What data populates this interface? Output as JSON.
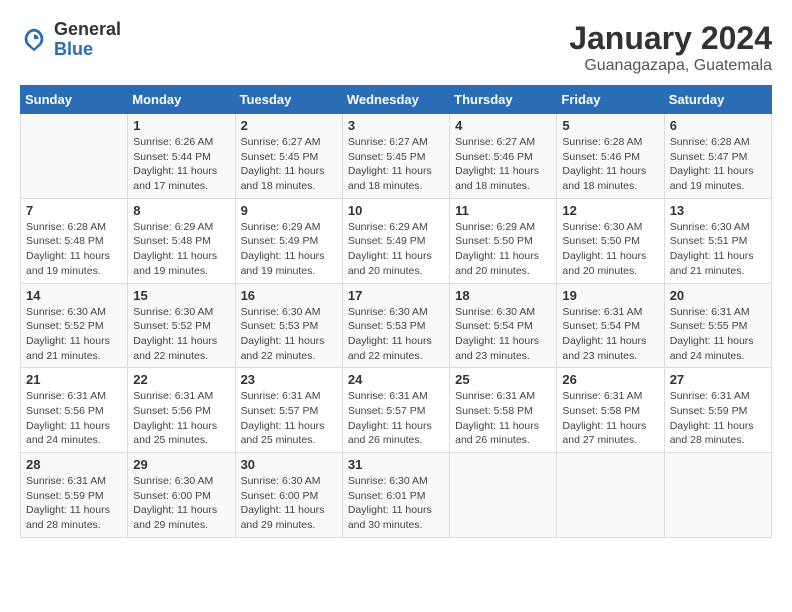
{
  "logo": {
    "general": "General",
    "blue": "Blue"
  },
  "title": "January 2024",
  "location": "Guanagazapa, Guatemala",
  "days_of_week": [
    "Sunday",
    "Monday",
    "Tuesday",
    "Wednesday",
    "Thursday",
    "Friday",
    "Saturday"
  ],
  "weeks": [
    [
      {
        "day": "",
        "info": ""
      },
      {
        "day": "1",
        "info": "Sunrise: 6:26 AM\nSunset: 5:44 PM\nDaylight: 11 hours and 17 minutes."
      },
      {
        "day": "2",
        "info": "Sunrise: 6:27 AM\nSunset: 5:45 PM\nDaylight: 11 hours and 18 minutes."
      },
      {
        "day": "3",
        "info": "Sunrise: 6:27 AM\nSunset: 5:45 PM\nDaylight: 11 hours and 18 minutes."
      },
      {
        "day": "4",
        "info": "Sunrise: 6:27 AM\nSunset: 5:46 PM\nDaylight: 11 hours and 18 minutes."
      },
      {
        "day": "5",
        "info": "Sunrise: 6:28 AM\nSunset: 5:46 PM\nDaylight: 11 hours and 18 minutes."
      },
      {
        "day": "6",
        "info": "Sunrise: 6:28 AM\nSunset: 5:47 PM\nDaylight: 11 hours and 19 minutes."
      }
    ],
    [
      {
        "day": "7",
        "info": "Sunrise: 6:28 AM\nSunset: 5:48 PM\nDaylight: 11 hours and 19 minutes."
      },
      {
        "day": "8",
        "info": "Sunrise: 6:29 AM\nSunset: 5:48 PM\nDaylight: 11 hours and 19 minutes."
      },
      {
        "day": "9",
        "info": "Sunrise: 6:29 AM\nSunset: 5:49 PM\nDaylight: 11 hours and 19 minutes."
      },
      {
        "day": "10",
        "info": "Sunrise: 6:29 AM\nSunset: 5:49 PM\nDaylight: 11 hours and 20 minutes."
      },
      {
        "day": "11",
        "info": "Sunrise: 6:29 AM\nSunset: 5:50 PM\nDaylight: 11 hours and 20 minutes."
      },
      {
        "day": "12",
        "info": "Sunrise: 6:30 AM\nSunset: 5:50 PM\nDaylight: 11 hours and 20 minutes."
      },
      {
        "day": "13",
        "info": "Sunrise: 6:30 AM\nSunset: 5:51 PM\nDaylight: 11 hours and 21 minutes."
      }
    ],
    [
      {
        "day": "14",
        "info": "Sunrise: 6:30 AM\nSunset: 5:52 PM\nDaylight: 11 hours and 21 minutes."
      },
      {
        "day": "15",
        "info": "Sunrise: 6:30 AM\nSunset: 5:52 PM\nDaylight: 11 hours and 22 minutes."
      },
      {
        "day": "16",
        "info": "Sunrise: 6:30 AM\nSunset: 5:53 PM\nDaylight: 11 hours and 22 minutes."
      },
      {
        "day": "17",
        "info": "Sunrise: 6:30 AM\nSunset: 5:53 PM\nDaylight: 11 hours and 22 minutes."
      },
      {
        "day": "18",
        "info": "Sunrise: 6:30 AM\nSunset: 5:54 PM\nDaylight: 11 hours and 23 minutes."
      },
      {
        "day": "19",
        "info": "Sunrise: 6:31 AM\nSunset: 5:54 PM\nDaylight: 11 hours and 23 minutes."
      },
      {
        "day": "20",
        "info": "Sunrise: 6:31 AM\nSunset: 5:55 PM\nDaylight: 11 hours and 24 minutes."
      }
    ],
    [
      {
        "day": "21",
        "info": "Sunrise: 6:31 AM\nSunset: 5:56 PM\nDaylight: 11 hours and 24 minutes."
      },
      {
        "day": "22",
        "info": "Sunrise: 6:31 AM\nSunset: 5:56 PM\nDaylight: 11 hours and 25 minutes."
      },
      {
        "day": "23",
        "info": "Sunrise: 6:31 AM\nSunset: 5:57 PM\nDaylight: 11 hours and 25 minutes."
      },
      {
        "day": "24",
        "info": "Sunrise: 6:31 AM\nSunset: 5:57 PM\nDaylight: 11 hours and 26 minutes."
      },
      {
        "day": "25",
        "info": "Sunrise: 6:31 AM\nSunset: 5:58 PM\nDaylight: 11 hours and 26 minutes."
      },
      {
        "day": "26",
        "info": "Sunrise: 6:31 AM\nSunset: 5:58 PM\nDaylight: 11 hours and 27 minutes."
      },
      {
        "day": "27",
        "info": "Sunrise: 6:31 AM\nSunset: 5:59 PM\nDaylight: 11 hours and 28 minutes."
      }
    ],
    [
      {
        "day": "28",
        "info": "Sunrise: 6:31 AM\nSunset: 5:59 PM\nDaylight: 11 hours and 28 minutes."
      },
      {
        "day": "29",
        "info": "Sunrise: 6:30 AM\nSunset: 6:00 PM\nDaylight: 11 hours and 29 minutes."
      },
      {
        "day": "30",
        "info": "Sunrise: 6:30 AM\nSunset: 6:00 PM\nDaylight: 11 hours and 29 minutes."
      },
      {
        "day": "31",
        "info": "Sunrise: 6:30 AM\nSunset: 6:01 PM\nDaylight: 11 hours and 30 minutes."
      },
      {
        "day": "",
        "info": ""
      },
      {
        "day": "",
        "info": ""
      },
      {
        "day": "",
        "info": ""
      }
    ]
  ]
}
